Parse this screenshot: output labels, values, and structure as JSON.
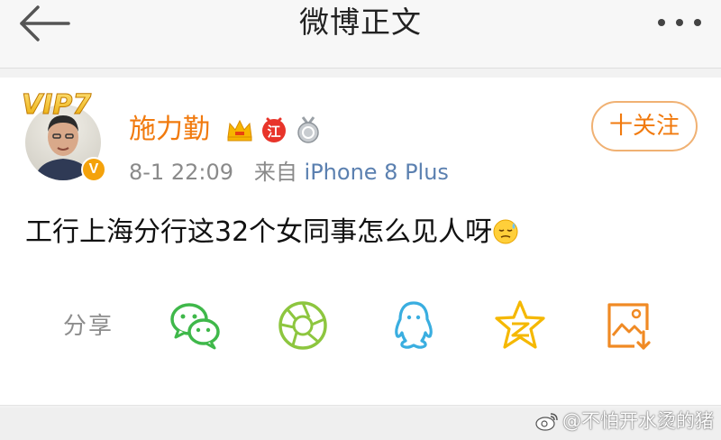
{
  "nav": {
    "title": "微博正文",
    "back_icon": "back-arrow-icon",
    "more_icon": "more-dots-icon"
  },
  "post": {
    "author": {
      "name": "施力勤",
      "vip_label": "VIP7",
      "verify_mark": "V",
      "badges": [
        "crown-icon",
        "red-badge-icon",
        "silver-medal-icon"
      ],
      "badge_text": "江"
    },
    "follow_label": "十关注",
    "time": "8-1 22:09",
    "source_prefix": "来自",
    "source": "iPhone 8 Plus",
    "text": "工行上海分行这32个女同事怎么见人呀"
  },
  "share": {
    "label": "分享",
    "targets": [
      "wechat-icon",
      "moments-icon",
      "qq-icon",
      "qzone-icon",
      "save-image-icon"
    ]
  },
  "watermark": {
    "text": "@不怕开水烫的猪"
  },
  "colors": {
    "accent": "#f17a0e",
    "follow_border": "#f0b173",
    "source_link": "#5b80b0",
    "wechat_green": "#3fb84a",
    "moments_green": "#8dc63f",
    "qq_blue": "#3aaee0",
    "qzone_yellow": "#f5b800",
    "save_orange": "#f08a24"
  }
}
